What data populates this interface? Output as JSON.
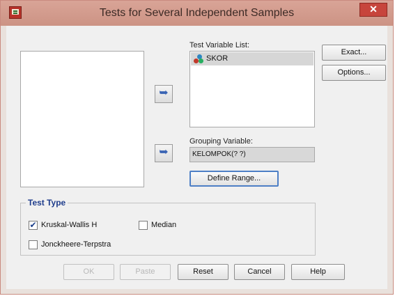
{
  "window": {
    "title": "Tests for Several Independent Samples",
    "close_glyph": "✕"
  },
  "source_variables": [],
  "arrows": {
    "glyph": "➥"
  },
  "test_variable_list": {
    "label": "Test Variable List:",
    "items": [
      {
        "name": "SKOR",
        "icon": "scale-variable-icon",
        "selected": true
      }
    ]
  },
  "grouping_variable": {
    "label": "Grouping Variable:",
    "value": "KELOMPOK(? ?)",
    "define_range_label": "Define Range..."
  },
  "side_buttons": {
    "exact_label": "Exact...",
    "options_label": "Options..."
  },
  "test_type": {
    "legend": "Test Type",
    "kruskal": {
      "label": "Kruskal-Wallis H",
      "checked": true
    },
    "median": {
      "label": "Median",
      "checked": false
    },
    "jonckheere": {
      "label": "Jonckheere-Terpstra",
      "checked": false
    }
  },
  "bottom_buttons": {
    "ok_label": "OK",
    "paste_label": "Paste",
    "reset_label": "Reset",
    "cancel_label": "Cancel",
    "help_label": "Help"
  },
  "check_glyph": "✔",
  "colors": {
    "titlebar": "#cc9384",
    "close": "#c7453c",
    "legend_text": "#1f3d8c",
    "focus_ring": "#4d7fc6",
    "arrow": "#3a64b4"
  }
}
